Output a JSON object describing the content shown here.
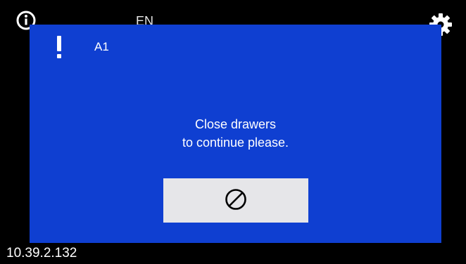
{
  "status_bar": {
    "info_icon": "info-circle-icon",
    "language": "EN",
    "settings_icon": "gear-icon"
  },
  "dialog": {
    "alert_icon": "exclamation-icon",
    "code": "A1",
    "message_line1": "Close drawers",
    "message_line2": "to continue please.",
    "cancel_icon": "prohibited-icon",
    "background_color": "#0f3fd1",
    "button_color": "#e6e6e9"
  },
  "footer": {
    "ip_address": "10.39.2.132"
  }
}
